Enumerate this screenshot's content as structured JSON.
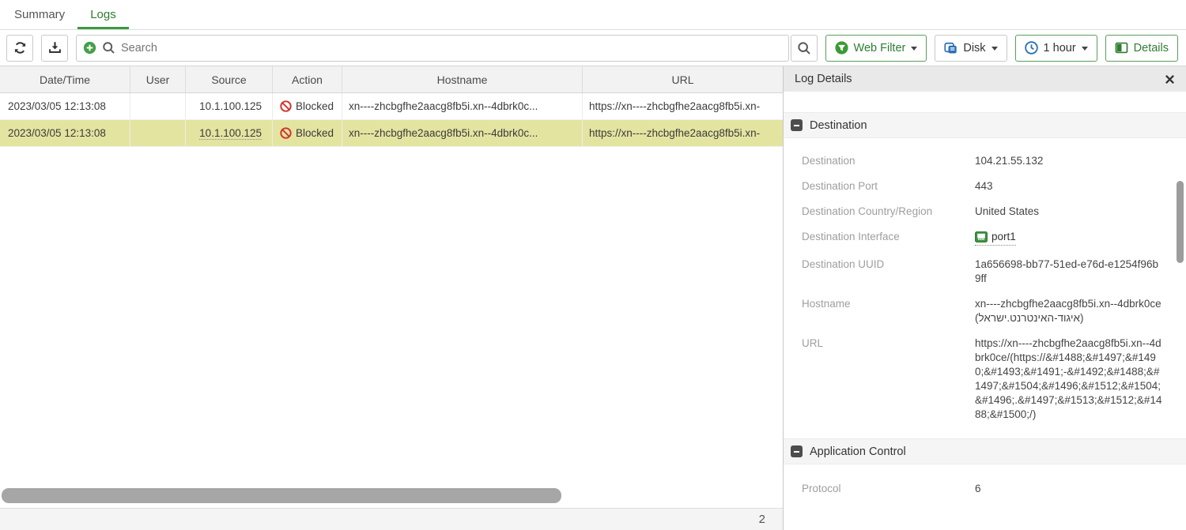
{
  "tabs": {
    "summary": "Summary",
    "logs": "Logs"
  },
  "toolbar": {
    "search_placeholder": "Search",
    "filter_label": "Web Filter",
    "source_label": "Disk",
    "time_label": "1 hour",
    "details_label": "Details"
  },
  "table": {
    "columns": {
      "datetime": "Date/Time",
      "user": "User",
      "source": "Source",
      "action": "Action",
      "hostname": "Hostname",
      "url": "URL"
    },
    "rows": [
      {
        "datetime": "2023/03/05 12:13:08",
        "user": "",
        "source": "10.1.100.125",
        "action": "Blocked",
        "hostname": "xn----zhcbgfhe2aacg8fb5i.xn--4dbrk0c...",
        "url": "https://xn----zhcbgfhe2aacg8fb5i.xn-"
      },
      {
        "datetime": "2023/03/05 12:13:08",
        "user": "",
        "source": "10.1.100.125",
        "action": "Blocked",
        "hostname": "xn----zhcbgfhe2aacg8fb5i.xn--4dbrk0c...",
        "url": "https://xn----zhcbgfhe2aacg8fb5i.xn-"
      }
    ],
    "total_count": "2"
  },
  "details": {
    "title": "Log Details",
    "sections": [
      {
        "title": "Destination",
        "fields": [
          {
            "label": "Destination",
            "value": "104.21.55.132"
          },
          {
            "label": "Destination Port",
            "value": "443"
          },
          {
            "label": "Destination Country/Region",
            "value": "United States"
          },
          {
            "label": "Destination Interface",
            "value": "port1"
          },
          {
            "label": "Destination UUID",
            "value": "1a656698-bb77-51ed-e76d-e1254f96b9ff"
          },
          {
            "label": "Hostname",
            "value": "xn----zhcbgfhe2aacg8fb5i.xn--4dbrk0ce (איגוד-האינטרנט.ישראל)"
          },
          {
            "label": "URL",
            "value": "https://xn----zhcbgfhe2aacg8fb5i.xn--4dbrk0ce/(https://&#1488;&#1497;&#1490;&#1493;&#1491;-&#1492;&#1488;&#1497;&#1504;&#1496;&#1512;&#1504;&#1496;.&#1497;&#1513;&#1512;&#1488;&#1500;/)"
          }
        ]
      },
      {
        "title": "Application Control",
        "fields": [
          {
            "label": "Protocol",
            "value": "6"
          }
        ]
      }
    ]
  },
  "icons": {
    "refresh": "circular-arrows",
    "download": "down-arrow-to-tray",
    "add_filter": "plus-circle",
    "search": "magnifier",
    "web_filter": "funnel-in-green-circle",
    "log_source": "blue-disk-stack",
    "time": "blue-clock",
    "details": "split-columns",
    "blocked": "red-no-entry",
    "interface": "green-ethernet-port",
    "collapse": "minus-square",
    "close": "x-mark"
  },
  "colors": {
    "accent_green": "#2e7d32",
    "tab_underline": "#3a9a3f",
    "selected_row": "#e4e4a1",
    "blocked_red": "#cf3730",
    "icon_blue": "#2a6fb5",
    "header_bg": "#f2f2f2",
    "panel_header_bg": "#e9e9e9"
  }
}
